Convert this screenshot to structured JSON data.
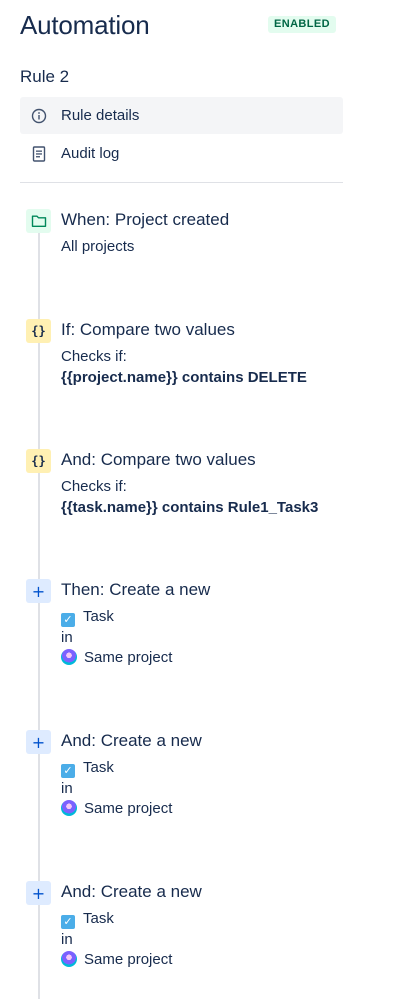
{
  "header": {
    "title": "Automation",
    "status_badge": "ENABLED",
    "rule_name": "Rule 2"
  },
  "nav": {
    "items": [
      {
        "label": "Rule details",
        "icon": "info-icon",
        "selected": true
      },
      {
        "label": "Audit log",
        "icon": "document-icon",
        "selected": false
      }
    ]
  },
  "steps": {
    "trigger": {
      "marker": "folder-icon",
      "title": "When: Project created",
      "detail": "All projects"
    },
    "condition1": {
      "marker": "{}",
      "title": "If: Compare two values",
      "label": "Checks if:",
      "expression": "{{project.name}} contains DELETE"
    },
    "condition2": {
      "marker": "{}",
      "title": "And: Compare two values",
      "label": "Checks if:",
      "expression": "{{task.name}} contains Rule1_Task3"
    },
    "action1": {
      "marker": "+",
      "title": "Then: Create a new",
      "issue_type": "Task",
      "preposition": "in",
      "project": "Same project"
    },
    "action2": {
      "marker": "+",
      "title": "And: Create a new",
      "issue_type": "Task",
      "preposition": "in",
      "project": "Same project"
    },
    "action3": {
      "marker": "+",
      "title": "And: Create a new",
      "issue_type": "Task",
      "preposition": "in",
      "project": "Same project"
    }
  },
  "colors": {
    "text": "#172b4d",
    "badge_bg": "#e3fcef",
    "badge_text": "#006644",
    "trigger_marker_bg": "#e3fcef",
    "condition_marker_bg": "#fff0b3",
    "action_marker_bg": "#deebff",
    "selected_nav_bg": "#f4f5f7"
  }
}
